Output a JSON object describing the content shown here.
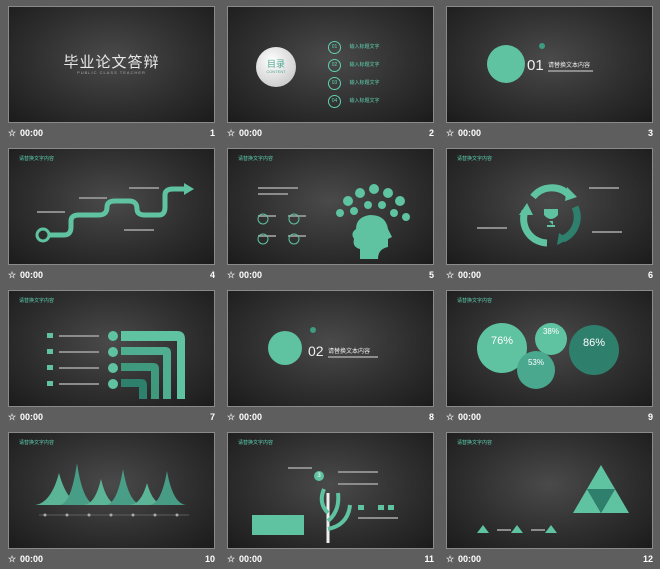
{
  "colors": {
    "accent": "#5fd1b0",
    "accent_dark": "#2e7f6c",
    "background": "#5e5e5e"
  },
  "slides": [
    {
      "number": "1",
      "time": "00:00",
      "title": "毕业论文答辩",
      "subtitle": "PUBLIC CLASS TEACHER"
    },
    {
      "number": "2",
      "time": "00:00",
      "toc_title": "目录",
      "toc_sub": "CONTENT",
      "items": [
        {
          "n": "01",
          "label": "输入标题文字"
        },
        {
          "n": "02",
          "label": "输入标题文字"
        },
        {
          "n": "03",
          "label": "输入标题文字"
        },
        {
          "n": "04",
          "label": "输入标题文字"
        }
      ]
    },
    {
      "number": "3",
      "time": "00:00",
      "sec_num": "01",
      "sec_title": "请替换文本内容"
    },
    {
      "number": "4",
      "time": "00:00",
      "header": "请替换文字内容"
    },
    {
      "number": "5",
      "time": "00:00",
      "header": "请替换文字内容"
    },
    {
      "number": "6",
      "time": "00:00",
      "header": "请替换文字内容"
    },
    {
      "number": "7",
      "time": "00:00",
      "header": "请替换文字内容"
    },
    {
      "number": "8",
      "time": "00:00",
      "sec_num": "02",
      "sec_title": "请替换文本内容"
    },
    {
      "number": "9",
      "time": "00:00",
      "header": "请替换文字内容",
      "percents": [
        "76%",
        "38%",
        "53%",
        "86%"
      ]
    },
    {
      "number": "10",
      "time": "00:00",
      "header": "请替换文字内容"
    },
    {
      "number": "11",
      "time": "00:00",
      "header": "请替换文字内容",
      "step": "3"
    },
    {
      "number": "12",
      "time": "00:00",
      "header": "请替换文字内容"
    }
  ]
}
